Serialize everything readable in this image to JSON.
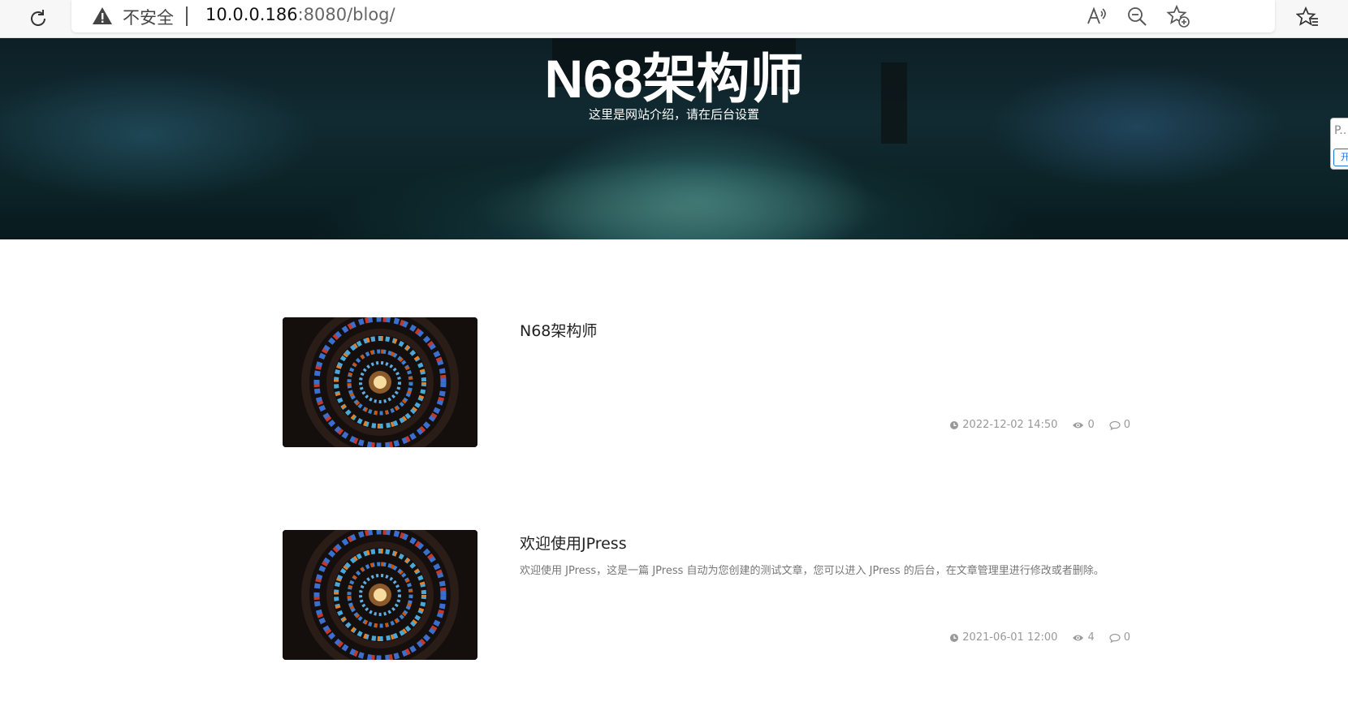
{
  "browser": {
    "security_label": "不安全",
    "url_host": "10.0.0.186",
    "url_rest": ":8080/blog/"
  },
  "site": {
    "title": "N68架构师",
    "description": "这里是网站介绍，请在后台设置"
  },
  "side_widget": {
    "text": "P..",
    "button": "开"
  },
  "articles": [
    {
      "title": "N68架构师",
      "summary": "",
      "date": "2022-12-02 14:50",
      "views": "0",
      "comments": "0"
    },
    {
      "title": "欢迎使用JPress",
      "summary": "欢迎使用 JPress，这是一篇 JPress 自动为您创建的测试文章，您可以进入 JPress 的后台，在文章管理里进行修改或者删除。",
      "date": "2021-06-01 12:00",
      "views": "4",
      "comments": "0"
    }
  ],
  "icons": {
    "reload": "reload-icon",
    "warning": "warning-icon",
    "read_aloud": "read-aloud-icon",
    "zoom_out": "zoom-out-icon",
    "add_favorite": "add-favorite-icon",
    "favorites": "favorites-icon",
    "clock": "clock-icon",
    "eye": "eye-icon",
    "comment": "comment-icon"
  }
}
